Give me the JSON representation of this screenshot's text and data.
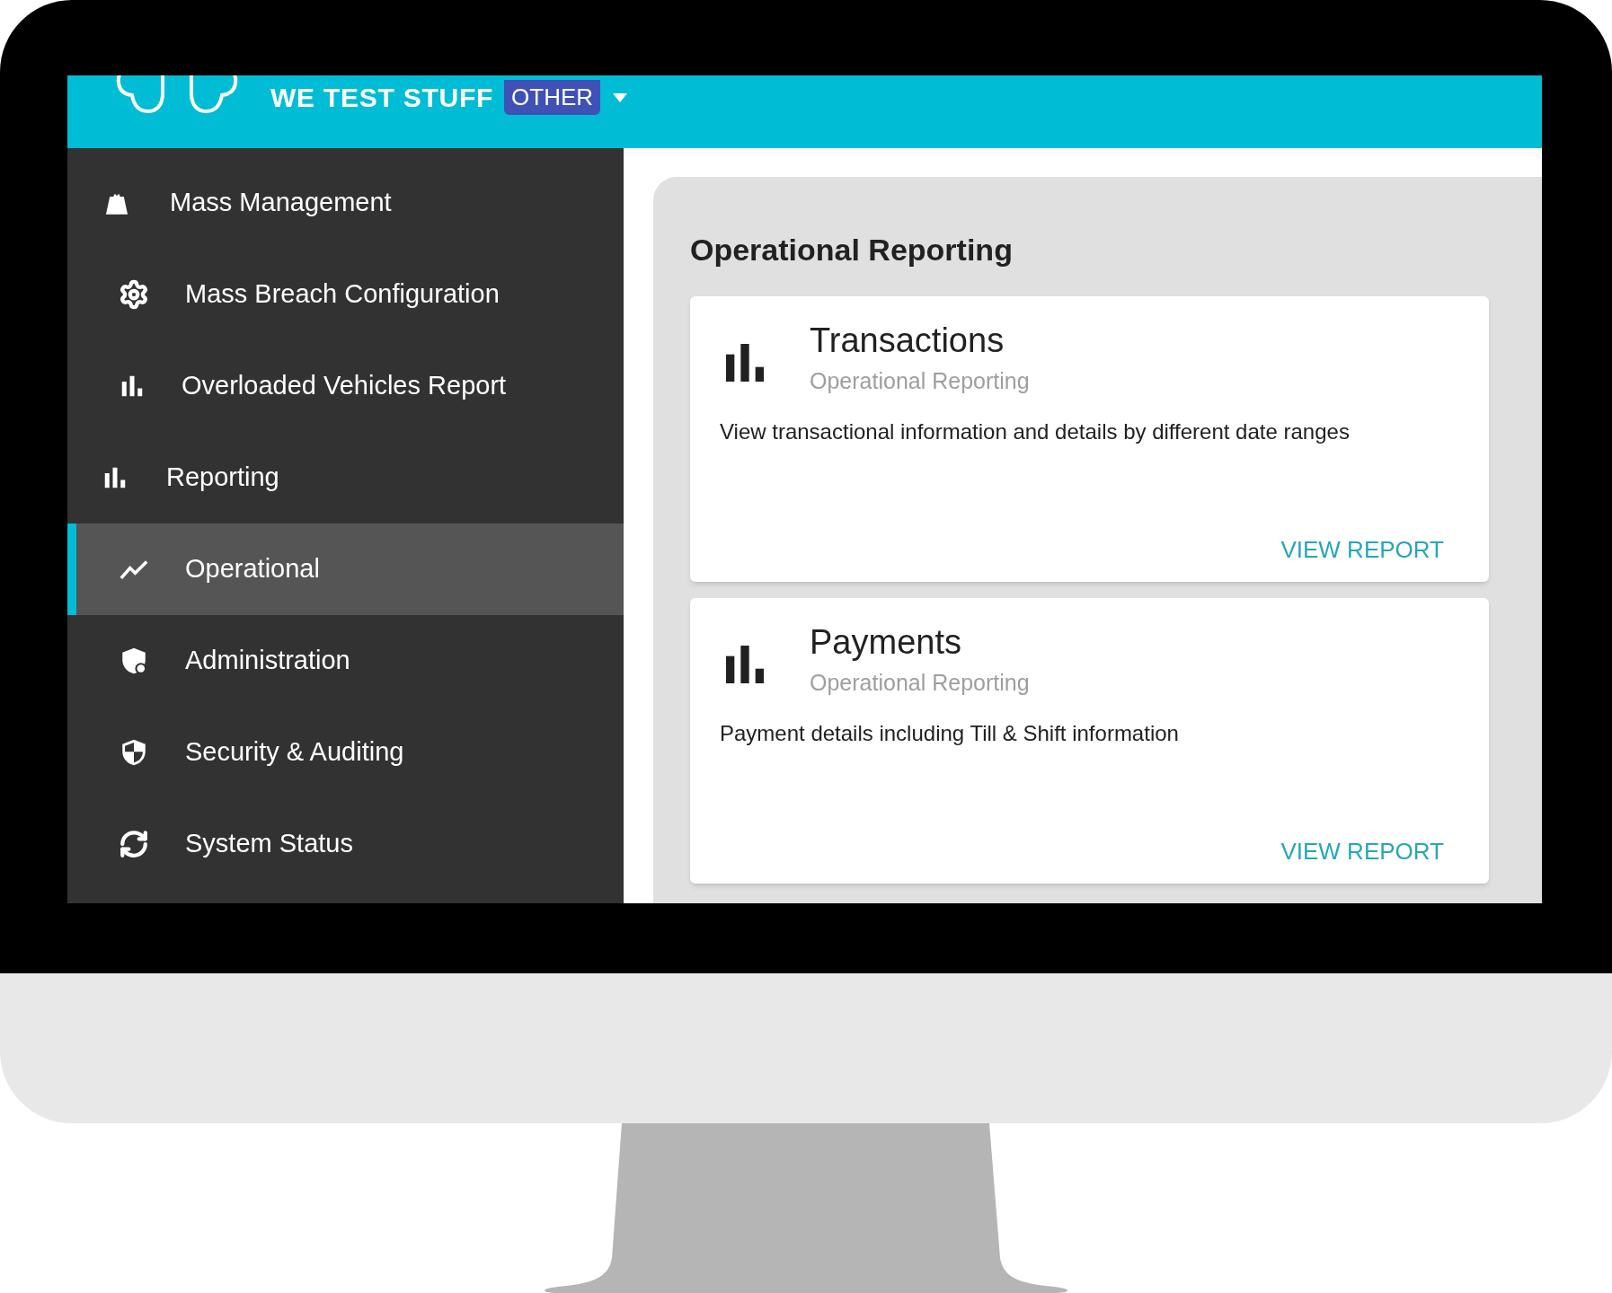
{
  "header": {
    "brand": "WE TEST STUFF",
    "badge": "OTHER"
  },
  "sidebar": {
    "items": [
      {
        "kind": "group",
        "label": "Mass Management",
        "selected": false,
        "children": [
          {
            "label": "Mass Breach Configuration",
            "selected": false
          },
          {
            "label": "Overloaded Vehicles Report",
            "selected": false
          }
        ]
      },
      {
        "kind": "group",
        "label": "Reporting",
        "selected": false,
        "children": [
          {
            "label": "Operational",
            "selected": true
          }
        ]
      },
      {
        "kind": "link",
        "label": "Administration",
        "selected": false
      },
      {
        "kind": "link",
        "label": "Security & Auditing",
        "selected": false
      },
      {
        "kind": "link",
        "label": "System Status",
        "selected": false
      }
    ]
  },
  "main": {
    "title": "Operational Reporting",
    "cards": [
      {
        "title": "Transactions",
        "subtitle": "Operational Reporting",
        "description": "View transactional information and details by different date ranges",
        "action": "VIEW REPORT"
      },
      {
        "title": "Payments",
        "subtitle": "Operational Reporting",
        "description": "Payment details including Till & Shift information",
        "action": "VIEW REPORT"
      }
    ]
  }
}
